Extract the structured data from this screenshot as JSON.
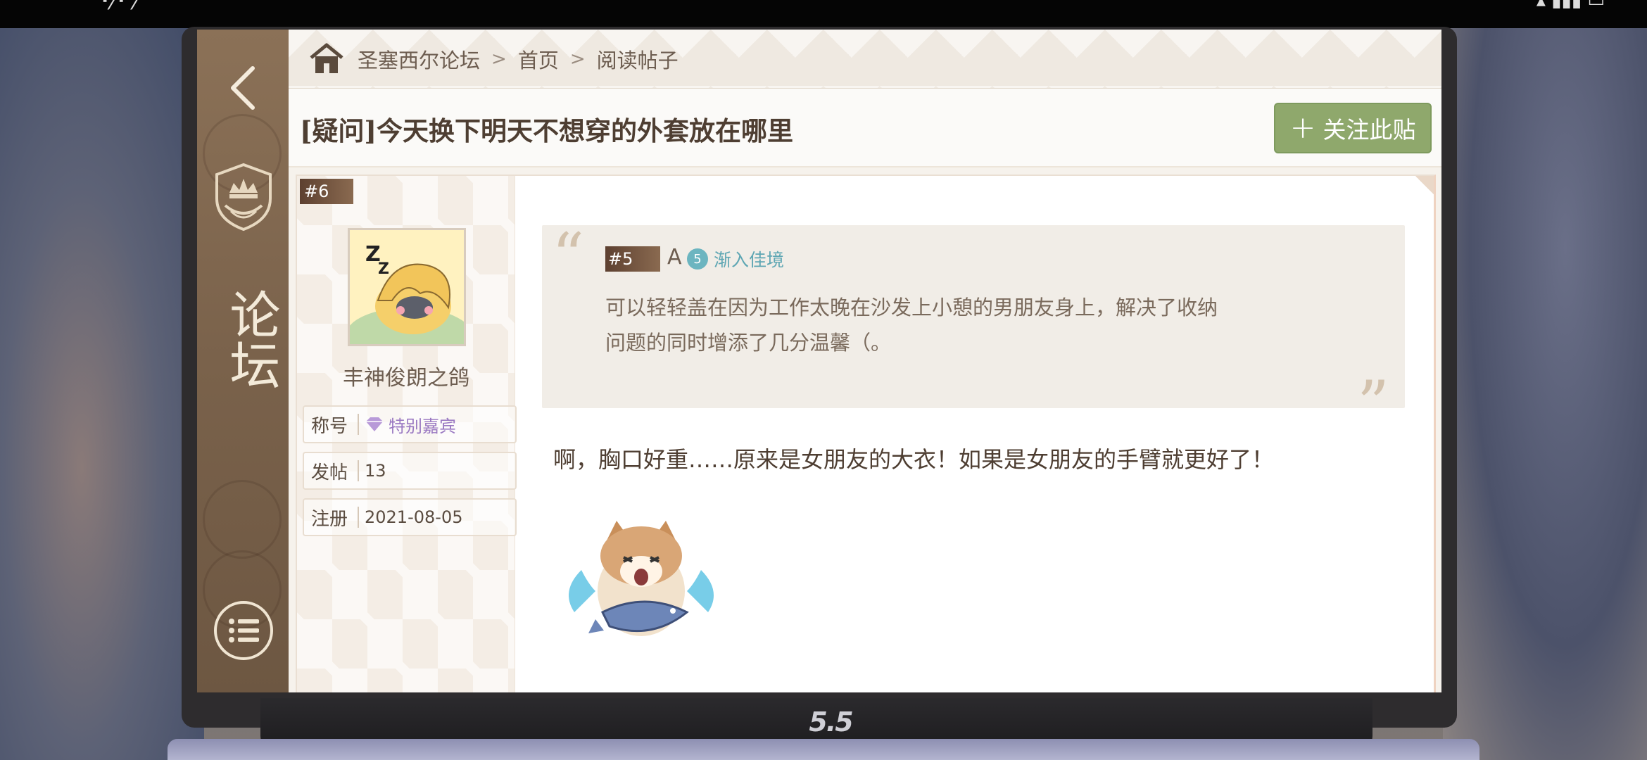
{
  "forum": {
    "sidebar_title": "论坛"
  },
  "breadcrumb": {
    "items": [
      "圣塞西尔论坛",
      "首页",
      "阅读帖子"
    ],
    "separator": ">"
  },
  "post": {
    "title": "[疑问]今天换下明天不想穿的外套放在哪里",
    "follow_label": "关注此贴",
    "follow_icon": "plus-icon"
  },
  "reply": {
    "floor": "#6",
    "username": "丰神俊朗之鸽",
    "stats": [
      {
        "key": "称号",
        "value": "特别嘉宾"
      },
      {
        "key": "发帖",
        "value": "13"
      },
      {
        "key": "注册",
        "value": "2021-08-05"
      }
    ],
    "quote": {
      "floor": "#5",
      "author": "A",
      "level": "5",
      "level_title": "渐入佳境",
      "text_line1": "可以轻轻盖在因为工作太晚在沙发上小憩的男朋友身上，解决了收纳",
      "text_line2": "问题的同时增添了几分温馨（。"
    },
    "content": "啊，胸口好重……原来是女朋友的大衣！如果是女朋友的手臂就更好了！",
    "sticker": "crying-cat-holding-fish"
  },
  "colors": {
    "accent_green": "#8fa86c",
    "sidebar_brown": "#7a624b",
    "title_brown": "#4e3e32",
    "vip_purple": "#9a79c2",
    "level_teal": "#5ea6b3"
  }
}
